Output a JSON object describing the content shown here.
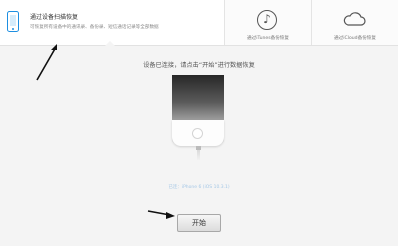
{
  "modes": {
    "device_scan": {
      "title": "通过设备扫描恢复",
      "description": "可恢复所有设备中的通讯录、备份录、短信通话记录等全部数据",
      "icon": "phone-icon",
      "active": true
    },
    "itunes": {
      "label": "通过iTunes备份恢复",
      "icon": "music-note-icon"
    },
    "icloud": {
      "label": "通过iCloud备份恢复",
      "icon": "cloud-icon"
    }
  },
  "main": {
    "instruction": "设备已连接，请点击“开始”进行数据恢复",
    "device_name": "已连：iPhone 6 (iOS 10.3.1)",
    "start_button": "开始"
  },
  "colors": {
    "accent": "#1e8fe1",
    "annotation_arrow": "#111111"
  }
}
